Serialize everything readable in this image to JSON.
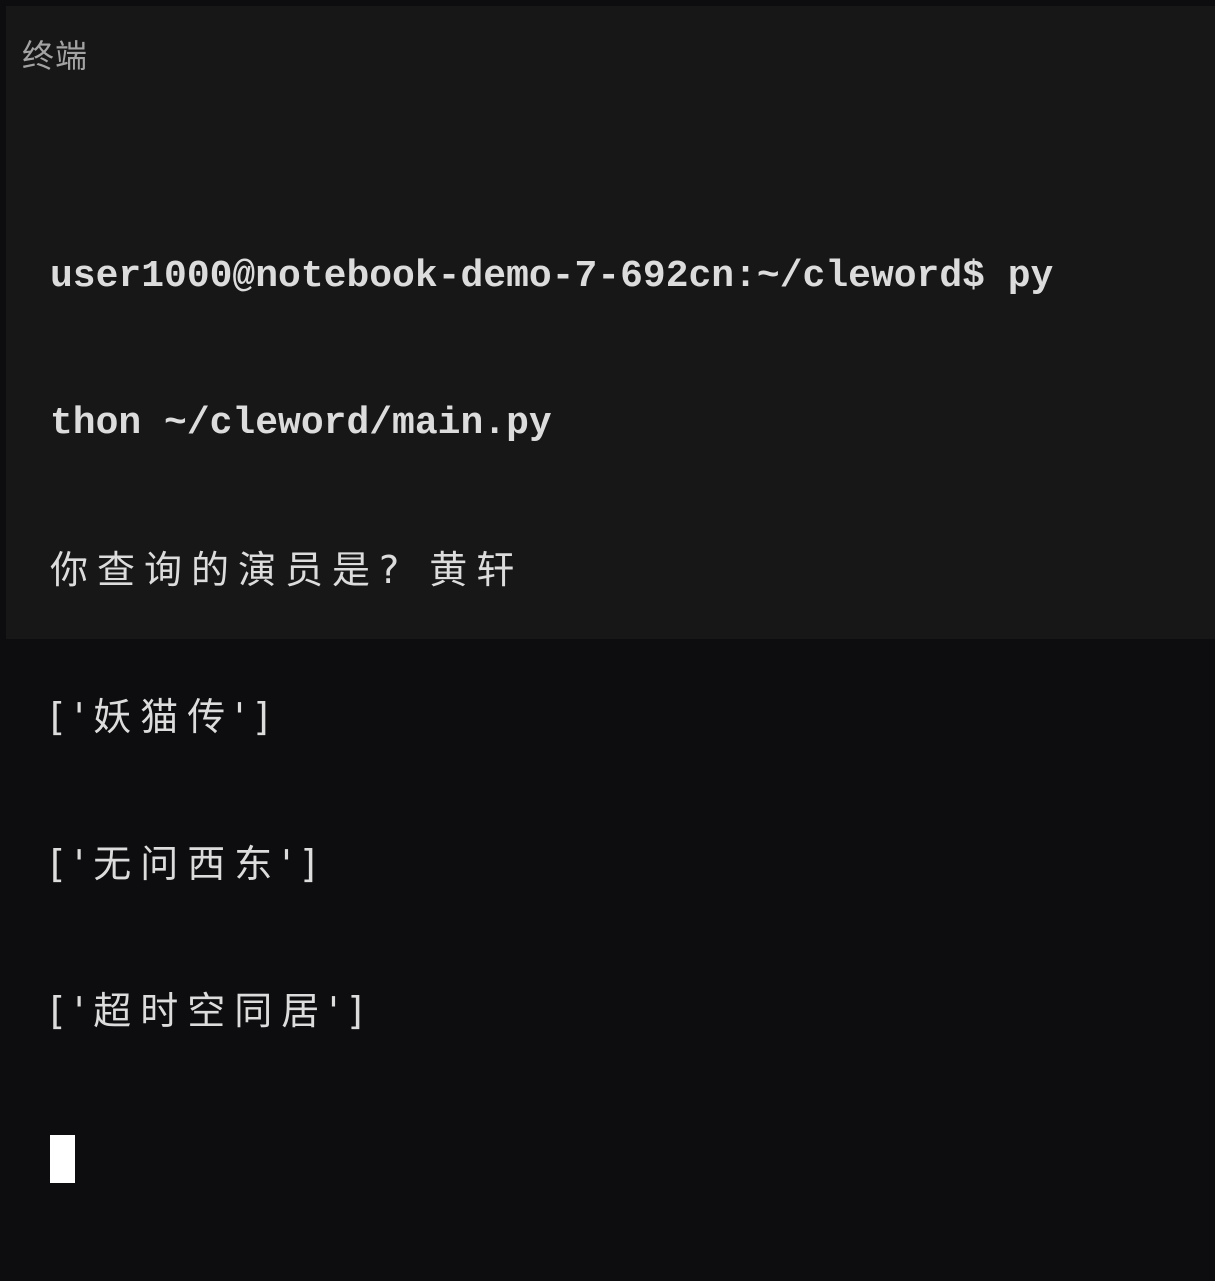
{
  "panel": {
    "title": "终端"
  },
  "terminal": {
    "lines": [
      "user1000@notebook-demo-7-692cn:~/cleword$ py",
      "thon ~/cleword/main.py",
      "你查询的演员是? 黄轩",
      "['妖猫传']",
      "['无问西东']",
      "['超时空同居']"
    ]
  },
  "colors": {
    "background": "#171717",
    "frame": "#0d0d0f",
    "title": "#a3a3a3",
    "text": "#dcdcdc",
    "cursor": "#ffffff"
  }
}
